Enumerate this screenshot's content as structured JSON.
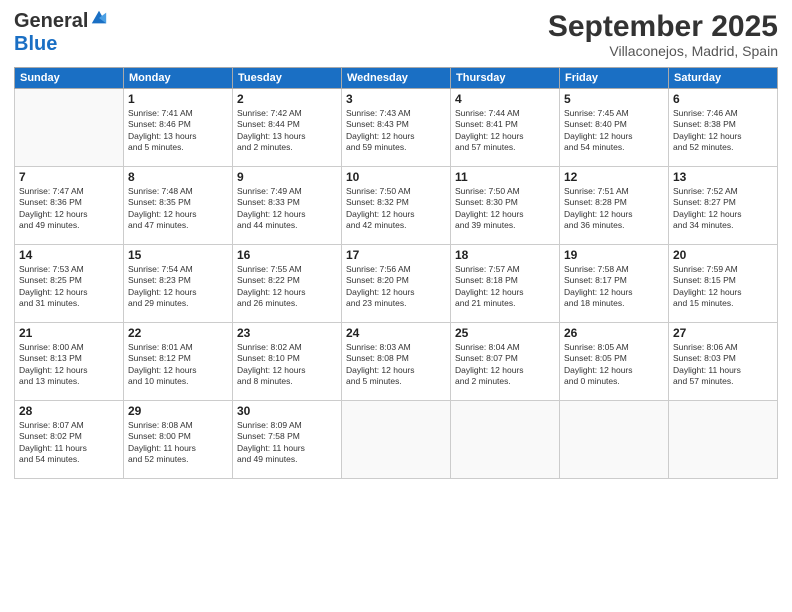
{
  "logo": {
    "general": "General",
    "blue": "Blue"
  },
  "title": "September 2025",
  "subtitle": "Villaconejos, Madrid, Spain",
  "days_of_week": [
    "Sunday",
    "Monday",
    "Tuesday",
    "Wednesday",
    "Thursday",
    "Friday",
    "Saturday"
  ],
  "weeks": [
    [
      {
        "day": "",
        "info": ""
      },
      {
        "day": "1",
        "info": "Sunrise: 7:41 AM\nSunset: 8:46 PM\nDaylight: 13 hours\nand 5 minutes."
      },
      {
        "day": "2",
        "info": "Sunrise: 7:42 AM\nSunset: 8:44 PM\nDaylight: 13 hours\nand 2 minutes."
      },
      {
        "day": "3",
        "info": "Sunrise: 7:43 AM\nSunset: 8:43 PM\nDaylight: 12 hours\nand 59 minutes."
      },
      {
        "day": "4",
        "info": "Sunrise: 7:44 AM\nSunset: 8:41 PM\nDaylight: 12 hours\nand 57 minutes."
      },
      {
        "day": "5",
        "info": "Sunrise: 7:45 AM\nSunset: 8:40 PM\nDaylight: 12 hours\nand 54 minutes."
      },
      {
        "day": "6",
        "info": "Sunrise: 7:46 AM\nSunset: 8:38 PM\nDaylight: 12 hours\nand 52 minutes."
      }
    ],
    [
      {
        "day": "7",
        "info": "Sunrise: 7:47 AM\nSunset: 8:36 PM\nDaylight: 12 hours\nand 49 minutes."
      },
      {
        "day": "8",
        "info": "Sunrise: 7:48 AM\nSunset: 8:35 PM\nDaylight: 12 hours\nand 47 minutes."
      },
      {
        "day": "9",
        "info": "Sunrise: 7:49 AM\nSunset: 8:33 PM\nDaylight: 12 hours\nand 44 minutes."
      },
      {
        "day": "10",
        "info": "Sunrise: 7:50 AM\nSunset: 8:32 PM\nDaylight: 12 hours\nand 42 minutes."
      },
      {
        "day": "11",
        "info": "Sunrise: 7:50 AM\nSunset: 8:30 PM\nDaylight: 12 hours\nand 39 minutes."
      },
      {
        "day": "12",
        "info": "Sunrise: 7:51 AM\nSunset: 8:28 PM\nDaylight: 12 hours\nand 36 minutes."
      },
      {
        "day": "13",
        "info": "Sunrise: 7:52 AM\nSunset: 8:27 PM\nDaylight: 12 hours\nand 34 minutes."
      }
    ],
    [
      {
        "day": "14",
        "info": "Sunrise: 7:53 AM\nSunset: 8:25 PM\nDaylight: 12 hours\nand 31 minutes."
      },
      {
        "day": "15",
        "info": "Sunrise: 7:54 AM\nSunset: 8:23 PM\nDaylight: 12 hours\nand 29 minutes."
      },
      {
        "day": "16",
        "info": "Sunrise: 7:55 AM\nSunset: 8:22 PM\nDaylight: 12 hours\nand 26 minutes."
      },
      {
        "day": "17",
        "info": "Sunrise: 7:56 AM\nSunset: 8:20 PM\nDaylight: 12 hours\nand 23 minutes."
      },
      {
        "day": "18",
        "info": "Sunrise: 7:57 AM\nSunset: 8:18 PM\nDaylight: 12 hours\nand 21 minutes."
      },
      {
        "day": "19",
        "info": "Sunrise: 7:58 AM\nSunset: 8:17 PM\nDaylight: 12 hours\nand 18 minutes."
      },
      {
        "day": "20",
        "info": "Sunrise: 7:59 AM\nSunset: 8:15 PM\nDaylight: 12 hours\nand 15 minutes."
      }
    ],
    [
      {
        "day": "21",
        "info": "Sunrise: 8:00 AM\nSunset: 8:13 PM\nDaylight: 12 hours\nand 13 minutes."
      },
      {
        "day": "22",
        "info": "Sunrise: 8:01 AM\nSunset: 8:12 PM\nDaylight: 12 hours\nand 10 minutes."
      },
      {
        "day": "23",
        "info": "Sunrise: 8:02 AM\nSunset: 8:10 PM\nDaylight: 12 hours\nand 8 minutes."
      },
      {
        "day": "24",
        "info": "Sunrise: 8:03 AM\nSunset: 8:08 PM\nDaylight: 12 hours\nand 5 minutes."
      },
      {
        "day": "25",
        "info": "Sunrise: 8:04 AM\nSunset: 8:07 PM\nDaylight: 12 hours\nand 2 minutes."
      },
      {
        "day": "26",
        "info": "Sunrise: 8:05 AM\nSunset: 8:05 PM\nDaylight: 12 hours\nand 0 minutes."
      },
      {
        "day": "27",
        "info": "Sunrise: 8:06 AM\nSunset: 8:03 PM\nDaylight: 11 hours\nand 57 minutes."
      }
    ],
    [
      {
        "day": "28",
        "info": "Sunrise: 8:07 AM\nSunset: 8:02 PM\nDaylight: 11 hours\nand 54 minutes."
      },
      {
        "day": "29",
        "info": "Sunrise: 8:08 AM\nSunset: 8:00 PM\nDaylight: 11 hours\nand 52 minutes."
      },
      {
        "day": "30",
        "info": "Sunrise: 8:09 AM\nSunset: 7:58 PM\nDaylight: 11 hours\nand 49 minutes."
      },
      {
        "day": "",
        "info": ""
      },
      {
        "day": "",
        "info": ""
      },
      {
        "day": "",
        "info": ""
      },
      {
        "day": "",
        "info": ""
      }
    ]
  ]
}
